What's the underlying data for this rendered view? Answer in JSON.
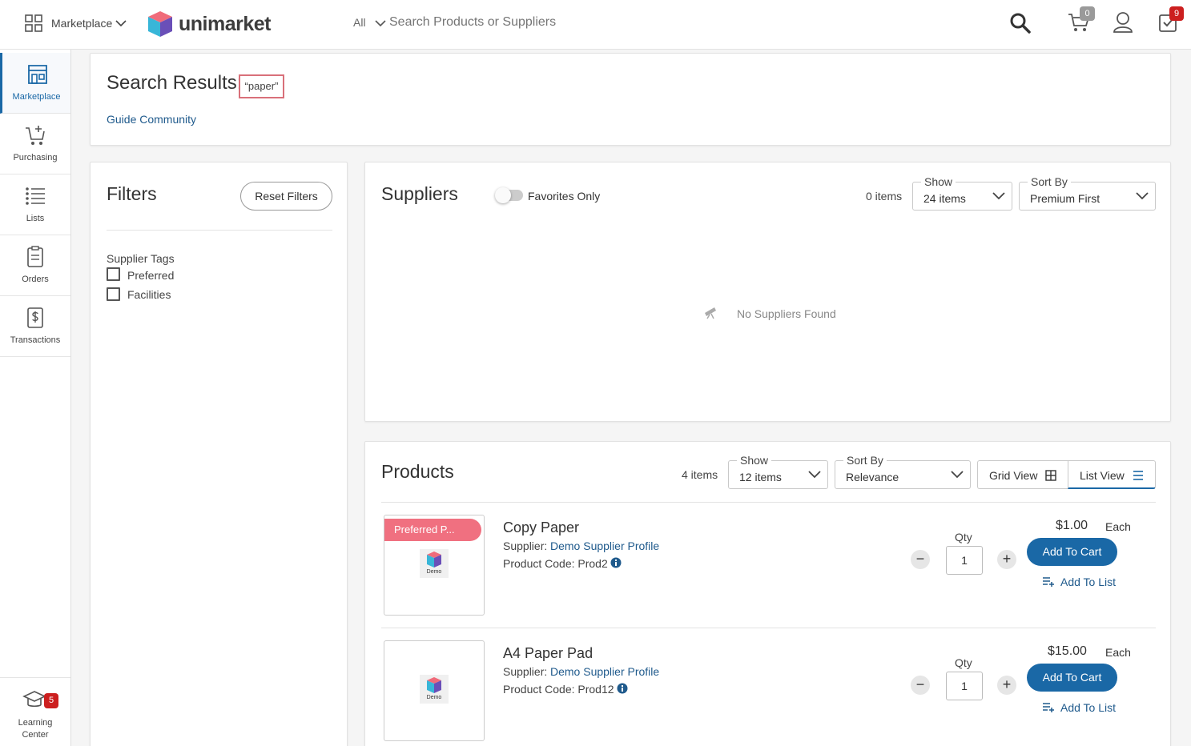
{
  "header": {
    "app_menu_label": "Marketplace",
    "brand": "unimarket",
    "search_scope": "All",
    "search_placeholder": "Search Products or Suppliers",
    "cart_count": "0",
    "tasks_count": "9"
  },
  "sidebar": {
    "items": [
      {
        "label": "Marketplace"
      },
      {
        "label": "Purchasing"
      },
      {
        "label": "Lists"
      },
      {
        "label": "Orders"
      },
      {
        "label": "Transactions"
      }
    ],
    "learning_center": {
      "label_line1": "Learning",
      "label_line2": "Center",
      "badge": "5"
    }
  },
  "results": {
    "title": "Search Results:",
    "query": "“paper”",
    "guide_link": "Guide Community"
  },
  "filters": {
    "title": "Filters",
    "reset_label": "Reset Filters",
    "group_label": "Supplier Tags",
    "options": [
      {
        "label": "Preferred"
      },
      {
        "label": "Facilities"
      }
    ]
  },
  "suppliers": {
    "title": "Suppliers",
    "favorites_label": "Favorites Only",
    "count": "0 items",
    "show_caption": "Show",
    "show_value": "24 items",
    "sort_caption": "Sort By",
    "sort_value": "Premium First",
    "empty_text": "No Suppliers Found"
  },
  "products": {
    "title": "Products",
    "count": "4 items",
    "show_caption": "Show",
    "show_value": "12 items",
    "sort_caption": "Sort By",
    "sort_value": "Relevance",
    "grid_view_label": "Grid View",
    "list_view_label": "List View",
    "items": [
      {
        "name": "Copy Paper",
        "supplier_prefix": "Supplier:",
        "supplier": "Demo Supplier Profile",
        "code": "Product Code: Prod2",
        "price": "$1.00",
        "unit": "Each",
        "qty_label": "Qty",
        "qty": "1",
        "add_cart": "Add To Cart",
        "add_list": "Add To List",
        "ribbon": "Preferred P...",
        "thumb_text": "Demo"
      },
      {
        "name": "A4 Paper Pad",
        "supplier_prefix": "Supplier:",
        "supplier": "Demo Supplier Profile",
        "code": "Product Code: Prod12",
        "price": "$15.00",
        "unit": "Each",
        "qty_label": "Qty",
        "qty": "1",
        "add_cart": "Add To Cart",
        "add_list": "Add To List",
        "thumb_text": "Demo"
      }
    ]
  },
  "colors": {
    "accent": "#1a68a6",
    "badge": "#cc1f1f",
    "ribbon": "#f07080",
    "link": "#1f5a8c"
  }
}
